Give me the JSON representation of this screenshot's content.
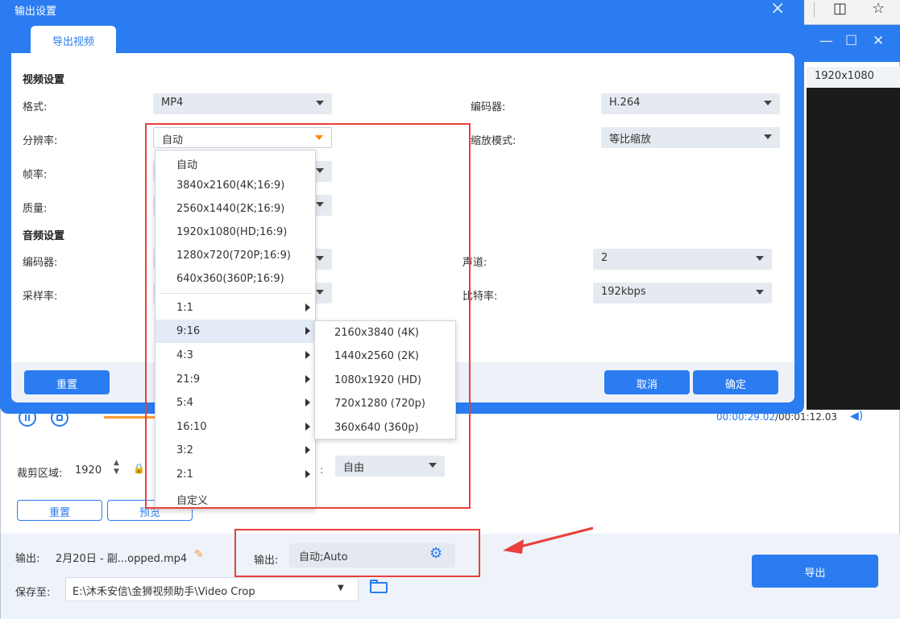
{
  "browser": {
    "split_icon": "split-view-icon",
    "fav_icon": "favorites-icon"
  },
  "main": {
    "resolution_label": "1920x1080",
    "time_current": "00:00:29.02",
    "time_total": "/00:01:12.03",
    "crop": {
      "label": "裁剪区域:",
      "width_value": "1920",
      "ratio_value": "自由"
    },
    "reset_label": "重置",
    "preview_label": "预览",
    "output": {
      "label": "输出:",
      "filename": "2月20日 - 副...opped.mp4",
      "format_label": "输出:",
      "format_value": "自动;Auto"
    },
    "export_label": "导出",
    "save": {
      "label": "保存至:",
      "path": "E:\\沐禾安信\\金狮视频助手\\Video Crop"
    }
  },
  "dialog": {
    "title": "输出设置",
    "tab": "导出视频",
    "video_section": "视频设置",
    "audio_section": "音频设置",
    "fields": {
      "format": {
        "label": "格式:",
        "value": "MP4"
      },
      "encoder": {
        "label": "编码器:",
        "value": "H.264"
      },
      "resolution": {
        "label": "分辨率:",
        "value": "自动"
      },
      "scale_mode": {
        "label": "缩放模式:",
        "value": "等比缩放"
      },
      "frame_rate": {
        "label": "帧率:"
      },
      "quality": {
        "label": "质量:"
      },
      "audio_encoder": {
        "label": "编码器:"
      },
      "channel": {
        "label": "声道:",
        "value": "2"
      },
      "sample_rate": {
        "label": "采样率:"
      },
      "bitrate": {
        "label": "比特率:",
        "value": "192kbps"
      }
    },
    "reset_label": "重置",
    "cancel_label": "取消",
    "ok_label": "确定"
  },
  "resolution_menu": {
    "items": [
      "自动",
      "3840x2160(4K;16:9)",
      "2560x1440(2K;16:9)",
      "1920x1080(HD;16:9)",
      "1280x720(720P;16:9)",
      "640x360(360P;16:9)"
    ],
    "ratios": [
      "1:1",
      "9:16",
      "4:3",
      "21:9",
      "5:4",
      "16:10",
      "3:2",
      "2:1"
    ],
    "custom": "自定义",
    "hovered": "9:16"
  },
  "ratio_submenu": {
    "items": [
      "2160x3840 (4K)",
      "1440x2560 (2K)",
      "1080x1920 (HD)",
      "720x1280 (720p)",
      "360x640 (360p)"
    ]
  },
  "colors": {
    "accent": "#2a7cf0",
    "highlight_orange": "#ff8a00",
    "annotation_red": "#e8403a"
  }
}
